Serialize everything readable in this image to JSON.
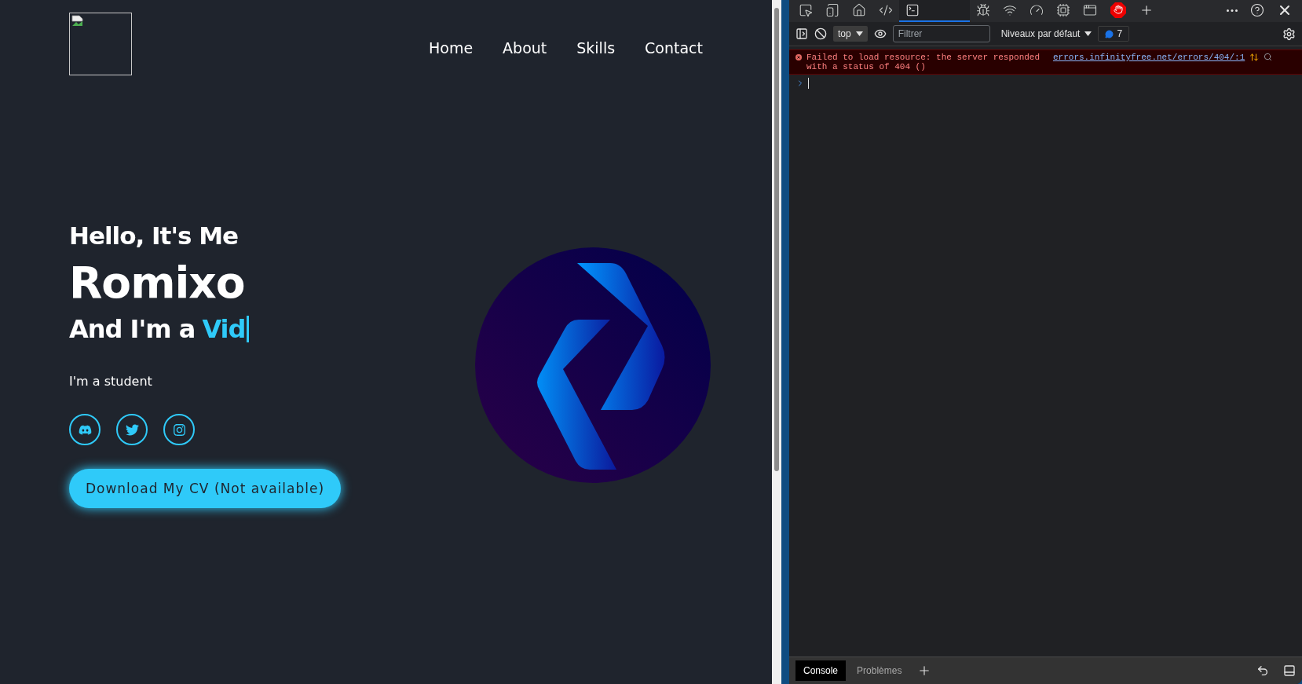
{
  "site": {
    "nav": [
      {
        "label": "Home"
      },
      {
        "label": "About"
      },
      {
        "label": "Skills"
      },
      {
        "label": "Contact"
      }
    ],
    "hero": {
      "greeting": "Hello, It's Me",
      "name": "Romixo",
      "role_prefix": "And I'm a",
      "role_typed": "Vid",
      "bio": "I'm a student",
      "socials": [
        {
          "kind": "discord"
        },
        {
          "kind": "twitter"
        },
        {
          "kind": "instagram"
        }
      ],
      "cta": "Download My CV (Not available)"
    }
  },
  "devtools": {
    "tools": [
      {
        "kind": "inspect",
        "selected": false
      },
      {
        "kind": "device",
        "selected": false
      },
      {
        "kind": "welcome",
        "selected": false
      },
      {
        "kind": "elements",
        "selected": false
      },
      {
        "kind": "console",
        "selected": true
      },
      {
        "kind": "sources",
        "selected": false
      },
      {
        "kind": "network",
        "selected": false
      },
      {
        "kind": "performance",
        "selected": false
      },
      {
        "kind": "memory",
        "selected": false
      },
      {
        "kind": "application",
        "selected": false
      },
      {
        "kind": "adblock",
        "selected": false
      }
    ],
    "context": "top",
    "filter": {
      "placeholder": "Filtrer"
    },
    "levels": "Niveaux par défaut",
    "issues_count": "7",
    "messages": [
      {
        "kind": "error",
        "text": "Failed to load resource: the server responded with a status of 404 ()",
        "source": "errors.infinityfree.net/errors/404/:1"
      }
    ],
    "drawer_tabs": [
      {
        "label": "Console",
        "selected": true
      },
      {
        "label": "Problèmes",
        "selected": false
      }
    ]
  }
}
